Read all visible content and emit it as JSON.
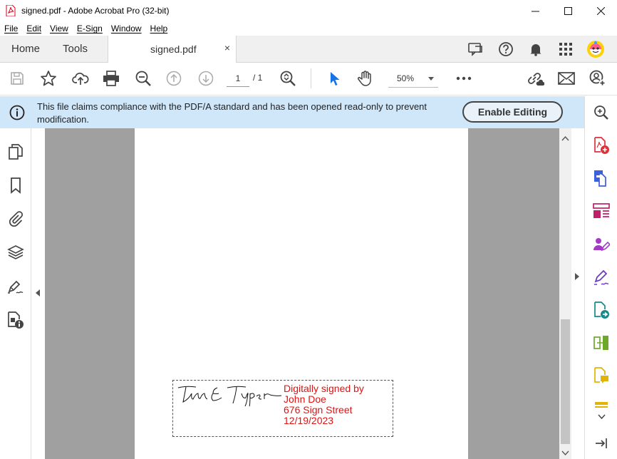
{
  "window": {
    "title": "signed.pdf - Adobe Acrobat Pro (32-bit)",
    "minimize": "—",
    "maximize": "☐",
    "close": "✕"
  },
  "menu": [
    "File",
    "Edit",
    "View",
    "E-Sign",
    "Window",
    "Help"
  ],
  "tabs": {
    "home": "Home",
    "tools": "Tools",
    "document": "signed.pdf",
    "close": "×"
  },
  "toolbar": {
    "current_page": "1",
    "page_total": "/ 1",
    "zoom": "50%"
  },
  "banner": {
    "message": "This file claims compliance with the PDF/A standard and has been opened read-only to prevent modification.",
    "button": "Enable Editing"
  },
  "signature": {
    "script": "Tim E Typer",
    "lines": [
      "Digitally signed by",
      "John Doe",
      "676 Sign Street",
      "12/19/2023"
    ],
    "color": "#e01212"
  },
  "colors": {
    "banner_bg": "#d0e6f9",
    "canvas_bg": "#a0a0a0",
    "accent_blue": "#1473e6"
  }
}
